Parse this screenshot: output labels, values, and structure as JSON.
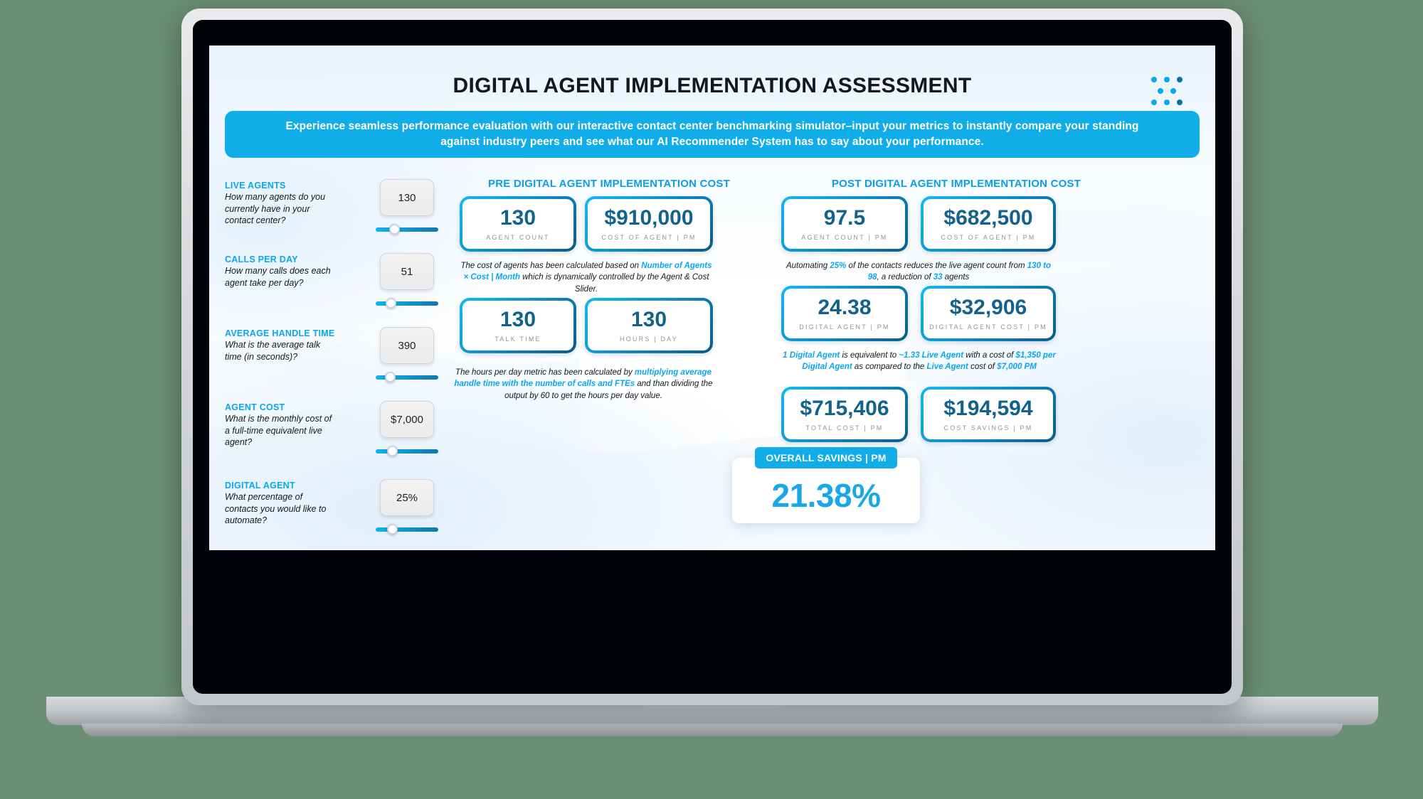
{
  "page_title": "DIGITAL AGENT IMPLEMENTATION ASSESSMENT",
  "banner": {
    "text": "Experience seamless performance evaluation with our interactive contact center benchmarking simulator–input your metrics to instantly compare your standing against industry peers and see what our AI Recommender System has to say about your performance."
  },
  "colors": {
    "accent": "#0aa6ef",
    "banner": "#10ade9",
    "value": "#12628c",
    "label": "#8b949b",
    "savings": "#19a7e8"
  },
  "controls": [
    {
      "label": "LIVE AGENTS",
      "question": "How many agents do you currently have in your contact center?",
      "value": "130",
      "slider_percent": 28
    },
    {
      "label": "CALLS PER DAY",
      "question": "How many calls does each agent take per day?",
      "value": "51",
      "slider_percent": 22
    },
    {
      "label": "AVERAGE HANDLE TIME",
      "question": "What is the average talk time (in seconds)?",
      "value": "390",
      "slider_percent": 21
    },
    {
      "label": "AGENT COST",
      "question": "What is the monthly cost of a full-time equivalent live agent?",
      "value": "$7,000",
      "slider_percent": 24
    },
    {
      "label": "DIGITAL AGENT",
      "question": "What percentage of contacts you would like to automate?",
      "value": "25%",
      "slider_percent": 24
    }
  ],
  "pre": {
    "heading": "PRE DIGITAL AGENT IMPLEMENTATION COST",
    "cards": [
      {
        "value": "130",
        "label": "AGENT COUNT"
      },
      {
        "value": "$910,000",
        "label": "COST OF AGENT | PM"
      },
      {
        "value": "130",
        "label": "TALK TIME"
      },
      {
        "value": "130",
        "label": "HOURS | DAY"
      }
    ],
    "note_1": {
      "part1": "The cost of agents has been calculated based on ",
      "highlight1": "Number of Agents × Cost | Month",
      "part2": " which is dynamically controlled by the Agent & Cost Slider."
    },
    "note_2": {
      "part1": "The hours per day metric has been calculated by ",
      "highlight1": "multiplying average handle time with the number of calls and FTEs",
      "part2": " and than dividing the output by 60 to get the hours per day value."
    }
  },
  "post": {
    "heading": "POST DIGITAL AGENT IMPLEMENTATION COST",
    "cards": [
      {
        "value": "97.5",
        "label": "AGENT COUNT | PM"
      },
      {
        "value": "$682,500",
        "label": "COST OF AGENT | PM"
      },
      {
        "value": "24.38",
        "label": "DIGITAL AGENT | PM"
      },
      {
        "value": "$32,906",
        "label": "DIGITAL AGENT COST | PM"
      },
      {
        "value": "$715,406",
        "label": "TOTAL COST | PM"
      },
      {
        "value": "$194,594",
        "label": "COST SAVINGS | PM"
      }
    ],
    "note_1": {
      "part1": "Automating ",
      "highlight1": "25%",
      "part2": " of the contacts reduces the live agent count from ",
      "highlight2": "130 to 98",
      "part3": ", a reduction of ",
      "highlight3": "33",
      "part4": " agents"
    },
    "note_2": {
      "highlight1": "1 Digital Agent",
      "part1": " is equivalent to ",
      "highlight2": "~1.33 Live Agent",
      "part2": " with a cost of ",
      "highlight3": "$1,350 per Digital Agent",
      "part3": " as compared to the ",
      "highlight4": "Live Agent",
      "part4": " cost of ",
      "highlight5": "$7,000 PM"
    }
  },
  "savings": {
    "tab_label": "OVERALL SAVINGS | PM",
    "value": "21.38%"
  }
}
